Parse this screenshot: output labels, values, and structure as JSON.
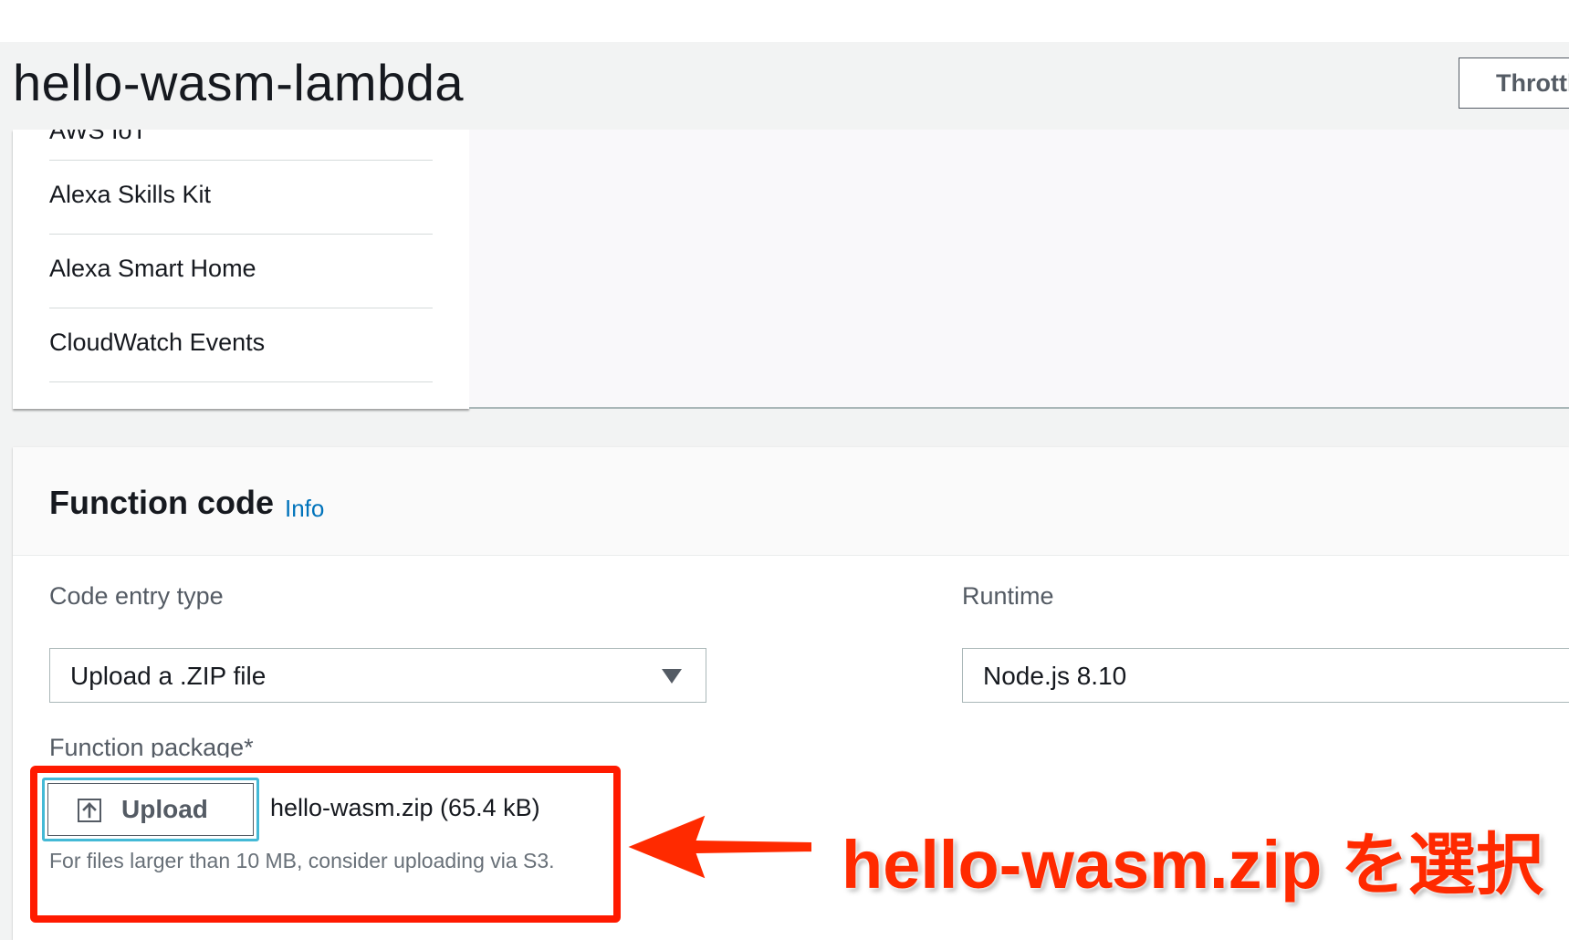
{
  "header": {
    "title": "hello-wasm-lambda",
    "throttle_label": "Throttle"
  },
  "triggers": {
    "items": [
      {
        "label": "AWS IoT"
      },
      {
        "label": "Alexa Skills Kit"
      },
      {
        "label": "Alexa Smart Home"
      },
      {
        "label": "CloudWatch Events"
      }
    ]
  },
  "function_code": {
    "title": "Function code",
    "info_link": "Info",
    "code_entry_label": "Code entry type",
    "code_entry_value": "Upload a .ZIP file",
    "runtime_label": "Runtime",
    "runtime_value": "Node.js 8.10",
    "package_label": "Function package*",
    "upload_label": "Upload",
    "file_name": "hello-wasm.zip (65.4 kB)",
    "help_text": "For files larger than 10 MB, consider uploading via S3."
  },
  "annotation": {
    "text": "hello-wasm.zip を選択",
    "color": "#ff2a00"
  },
  "colors": {
    "link": "#0073bb",
    "focus": "#44b9d6",
    "highlight": "#ff1a00"
  }
}
